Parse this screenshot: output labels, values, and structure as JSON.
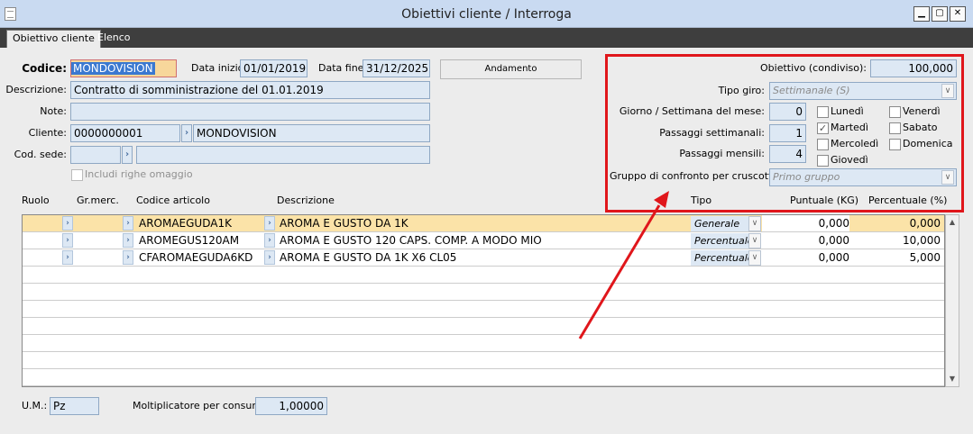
{
  "window": {
    "title": "Obiettivi cliente / Interroga",
    "controls": [
      "▁",
      "▢",
      "✕"
    ]
  },
  "tabs": [
    {
      "label": "Obiettivo cliente"
    },
    {
      "label": "Elenco"
    }
  ],
  "form": {
    "codice_label": "Codice:",
    "codice_value": "MONDOVISION",
    "data_inizio_label": "Data inizio:",
    "data_inizio_value": "01/01/2019",
    "data_fine_label": "Data fine:",
    "data_fine_value": "31/12/2025",
    "andamento_label": "Andamento",
    "descrizione_label": "Descrizione:",
    "descrizione_value": "Contratto di somministrazione del 01.01.2019",
    "note_label": "Note:",
    "note_value": "",
    "cliente_label": "Cliente:",
    "cliente_code": "0000000001",
    "cliente_name": "MONDOVISION",
    "cod_sede_label": "Cod. sede:",
    "cod_sede_value": "",
    "cod_sede_desc": "",
    "omaggio_label": "Includi righe omaggio"
  },
  "panel": {
    "obiettivo_label": "Obiettivo (condiviso):",
    "obiettivo_value": "100,000",
    "tipo_giro_label": "Tipo giro:",
    "tipo_giro_value": "Settimanale (S)",
    "giorno_label": "Giorno / Settimana del mese:",
    "giorno_value": "0",
    "passaggi_sett_label": "Passaggi settimanali:",
    "passaggi_sett_value": "1",
    "passaggi_mens_label": "Passaggi mensili:",
    "passaggi_mens_value": "4",
    "gruppo_label": "Gruppo di confronto per cruscotto:",
    "gruppo_value": "Primo gruppo",
    "days": [
      {
        "label": "Lunedì",
        "checked": false
      },
      {
        "label": "Venerdì",
        "checked": false
      },
      {
        "label": "Martedì",
        "checked": true
      },
      {
        "label": "Sabato",
        "checked": false
      },
      {
        "label": "Mercoledì",
        "checked": false
      },
      {
        "label": "Domenica",
        "checked": false
      },
      {
        "label": "Giovedì",
        "checked": false
      }
    ]
  },
  "grid": {
    "headers": {
      "ruolo": "Ruolo",
      "grmerc": "Gr.merc.",
      "codice": "Codice articolo",
      "descrizione": "Descrizione",
      "tipo": "Tipo",
      "puntuale": "Puntuale (KG)",
      "percentuale": "Percentuale (%)"
    },
    "rows": [
      {
        "ruolo": "",
        "grmerc": "",
        "codice": "AROMAEGUDA1K",
        "descrizione": "AROMA E GUSTO DA 1K",
        "tipo": "Generale",
        "puntuale": "0,000",
        "percentuale": "0,000"
      },
      {
        "ruolo": "",
        "grmerc": "",
        "codice": "AROMEGUS120AM",
        "descrizione": "AROMA E GUSTO 120 CAPS. COMP. A MODO MIO",
        "tipo": "Percentuale",
        "puntuale": "0,000",
        "percentuale": "10,000"
      },
      {
        "ruolo": "",
        "grmerc": "",
        "codice": "CFAROMAEGUDA6KD",
        "descrizione": "AROMA E GUSTO DA 1K X6 CL05",
        "tipo": "Percentuale",
        "puntuale": "0,000",
        "percentuale": "5,000"
      }
    ]
  },
  "footer": {
    "um_label": "U.M.:",
    "um_value": "Pz",
    "molt_label": "Moltiplicatore per consumo:",
    "molt_value": "1,00000"
  },
  "icons": {
    "zoom": "›",
    "dropdown": "∨",
    "check": "✓",
    "scroll_up": "▲",
    "scroll_down": "▼"
  },
  "colors": {
    "title_bar": "#c9daf1",
    "annotation": "#e0161b",
    "selected_row": "#fbe3a8",
    "field_bg": "#dde8f4"
  }
}
